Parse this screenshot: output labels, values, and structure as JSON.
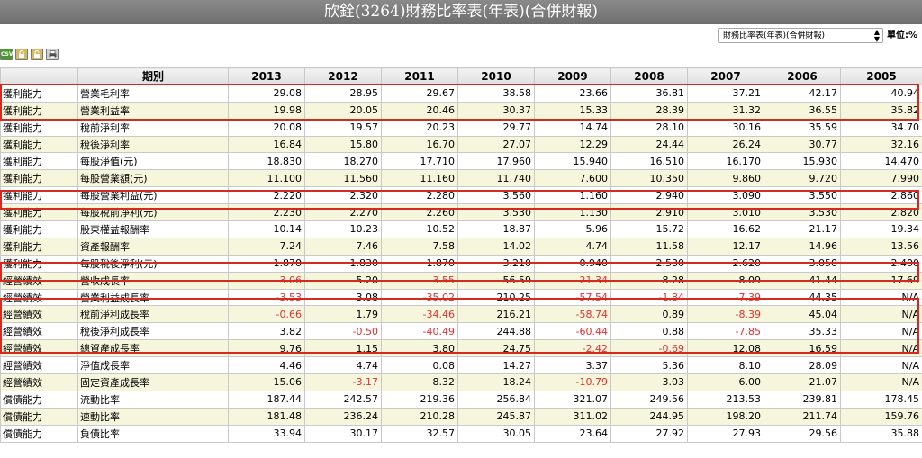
{
  "title": "欣銓(3264)財務比率表(年表)(合併財報)",
  "selector": {
    "value": "財務比率表(年表)(合併財報)"
  },
  "unit_label": "單位:%",
  "toolbar": {
    "csv_label": "CSV"
  },
  "table": {
    "period_header": "期別",
    "years": [
      "2013",
      "2012",
      "2011",
      "2010",
      "2009",
      "2008",
      "2007",
      "2006",
      "2005"
    ],
    "rows": [
      {
        "cat": "獲利能力",
        "item": "營業毛利率",
        "values": [
          "29.08",
          "28.95",
          "29.67",
          "38.58",
          "23.66",
          "36.81",
          "37.21",
          "42.17",
          "40.94"
        ]
      },
      {
        "cat": "獲利能力",
        "item": "營業利益率",
        "values": [
          "19.98",
          "20.05",
          "20.46",
          "30.37",
          "15.33",
          "28.39",
          "31.32",
          "36.55",
          "35.82"
        ]
      },
      {
        "cat": "獲利能力",
        "item": "稅前淨利率",
        "values": [
          "20.08",
          "19.57",
          "20.23",
          "29.77",
          "14.74",
          "28.10",
          "30.16",
          "35.59",
          "34.70"
        ]
      },
      {
        "cat": "獲利能力",
        "item": "稅後淨利率",
        "values": [
          "16.84",
          "15.80",
          "16.70",
          "27.07",
          "12.29",
          "24.44",
          "26.24",
          "30.77",
          "32.16"
        ]
      },
      {
        "cat": "獲利能力",
        "item": "每股淨值(元)",
        "values": [
          "18.830",
          "18.270",
          "17.710",
          "17.960",
          "15.940",
          "16.510",
          "16.170",
          "15.930",
          "14.470"
        ]
      },
      {
        "cat": "獲利能力",
        "item": "每股營業額(元)",
        "values": [
          "11.100",
          "11.560",
          "11.160",
          "11.740",
          "7.600",
          "10.350",
          "9.860",
          "9.720",
          "7.990"
        ]
      },
      {
        "cat": "獲利能力",
        "item": "每股營業利益(元)",
        "values": [
          "2.220",
          "2.320",
          "2.280",
          "3.560",
          "1.160",
          "2.940",
          "3.090",
          "3.550",
          "2.860"
        ]
      },
      {
        "cat": "獲利能力",
        "item": "每股稅前淨利(元)",
        "values": [
          "2.230",
          "2.270",
          "2.260",
          "3.530",
          "1.130",
          "2.910",
          "3.010",
          "3.530",
          "2.820"
        ]
      },
      {
        "cat": "獲利能力",
        "item": "股東權益報酬率",
        "values": [
          "10.14",
          "10.23",
          "10.52",
          "18.87",
          "5.96",
          "15.72",
          "16.62",
          "21.17",
          "19.34"
        ]
      },
      {
        "cat": "獲利能力",
        "item": "資產報酬率",
        "values": [
          "7.24",
          "7.46",
          "7.58",
          "14.02",
          "4.74",
          "11.58",
          "12.17",
          "14.96",
          "13.56"
        ]
      },
      {
        "cat": "獲利能力",
        "item": "每股稅後淨利(元)",
        "values": [
          "1.870",
          "1.830",
          "1.870",
          "3.210",
          "0.940",
          "2.530",
          "2.620",
          "3.050",
          "2.400"
        ]
      },
      {
        "cat": "經營績效",
        "item": "營收成長率",
        "values": [
          "-3.06",
          "5.20",
          "-3.55",
          "56.59",
          "-21.34",
          "8.28",
          "8.09",
          "41.44",
          "17.69"
        ]
      },
      {
        "cat": "經營績效",
        "item": "營業利益成長率",
        "values": [
          "-3.53",
          "3.08",
          "-35.02",
          "210.25",
          "-57.54",
          "-1.84",
          "-7.39",
          "44.35",
          "N/A"
        ]
      },
      {
        "cat": "經營績效",
        "item": "稅前淨利成長率",
        "values": [
          "-0.66",
          "1.79",
          "-34.46",
          "216.21",
          "-58.74",
          "0.89",
          "-8.39",
          "45.04",
          "N/A"
        ]
      },
      {
        "cat": "經營績效",
        "item": "稅後淨利成長率",
        "values": [
          "3.82",
          "-0.50",
          "-40.49",
          "244.88",
          "-60.44",
          "0.88",
          "-7.85",
          "35.33",
          "N/A"
        ]
      },
      {
        "cat": "經營績效",
        "item": "總資產成長率",
        "values": [
          "9.76",
          "1.15",
          "3.80",
          "24.75",
          "-2.42",
          "-0.69",
          "12.08",
          "16.59",
          "N/A"
        ]
      },
      {
        "cat": "經營績效",
        "item": "淨值成長率",
        "values": [
          "4.46",
          "4.74",
          "0.08",
          "14.27",
          "3.37",
          "5.36",
          "8.10",
          "28.09",
          "N/A"
        ]
      },
      {
        "cat": "經營績效",
        "item": "固定資產成長率",
        "values": [
          "15.06",
          "-3.17",
          "8.32",
          "18.24",
          "-10.79",
          "3.03",
          "6.00",
          "21.07",
          "N/A"
        ]
      },
      {
        "cat": "償債能力",
        "item": "流動比率",
        "values": [
          "187.44",
          "242.57",
          "219.36",
          "256.84",
          "321.07",
          "249.56",
          "213.53",
          "239.81",
          "178.45"
        ]
      },
      {
        "cat": "償債能力",
        "item": "速動比率",
        "values": [
          "181.48",
          "236.24",
          "210.28",
          "245.87",
          "311.02",
          "244.95",
          "198.20",
          "211.74",
          "159.76"
        ]
      },
      {
        "cat": "償債能力",
        "item": "負債比率",
        "values": [
          "33.94",
          "30.17",
          "32.57",
          "30.05",
          "23.64",
          "27.92",
          "27.93",
          "29.56",
          "35.88"
        ]
      }
    ]
  },
  "colors": {
    "highlight": "#d42a1f",
    "negative": "#e03030",
    "row_alt": "#f6f6dc"
  }
}
